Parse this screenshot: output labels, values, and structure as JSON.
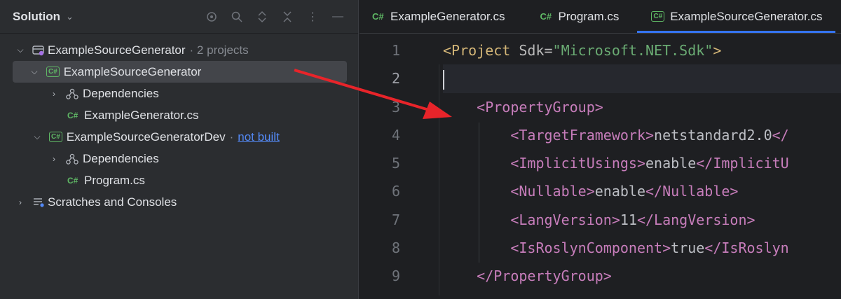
{
  "sidebar": {
    "title": "Solution",
    "tree": [
      {
        "label": "ExampleSourceGenerator",
        "suffix": "· 2 projects"
      },
      {
        "label": "ExampleSourceGenerator"
      },
      {
        "label": "Dependencies"
      },
      {
        "label": "ExampleGenerator.cs",
        "badge": "C#"
      },
      {
        "label": "ExampleSourceGeneratorDev",
        "link": "not built"
      },
      {
        "label": "Dependencies"
      },
      {
        "label": "Program.cs",
        "badge": "C#"
      },
      {
        "label": "Scratches and Consoles"
      }
    ],
    "project_badge": "C#"
  },
  "tabs": [
    {
      "label": "ExampleGenerator.cs",
      "badge": "C#"
    },
    {
      "label": "Program.cs",
      "badge": "C#"
    },
    {
      "label": "ExampleSourceGenerator.cs",
      "badge": "C#"
    }
  ],
  "editor": {
    "line_numbers": [
      "1",
      "2",
      "3",
      "4",
      "5",
      "6",
      "7",
      "8",
      "9"
    ],
    "lines": {
      "l1": {
        "open": "<Project",
        "attr": " Sdk=",
        "val": "\"Microsoft.NET.Sdk\"",
        "close": ">"
      },
      "l3": "<PropertyGroup>",
      "l4": {
        "open": "<TargetFramework>",
        "text": "netstandard2.0",
        "close": "</"
      },
      "l5": {
        "open": "<ImplicitUsings>",
        "text": "enable",
        "close": "</ImplicitU"
      },
      "l6": {
        "open": "<Nullable>",
        "text": "enable",
        "close": "</Nullable>"
      },
      "l7": {
        "open": "<LangVersion>",
        "text": "11",
        "close": "</LangVersion>"
      },
      "l8": {
        "open": "<IsRoslynComponent>",
        "text": "true",
        "close": "</IsRoslyn"
      },
      "l9": "</PropertyGroup>"
    }
  },
  "colors": {
    "accent": "#3574f0",
    "arrow": "#e8242a",
    "cs_green": "#5fb865"
  }
}
